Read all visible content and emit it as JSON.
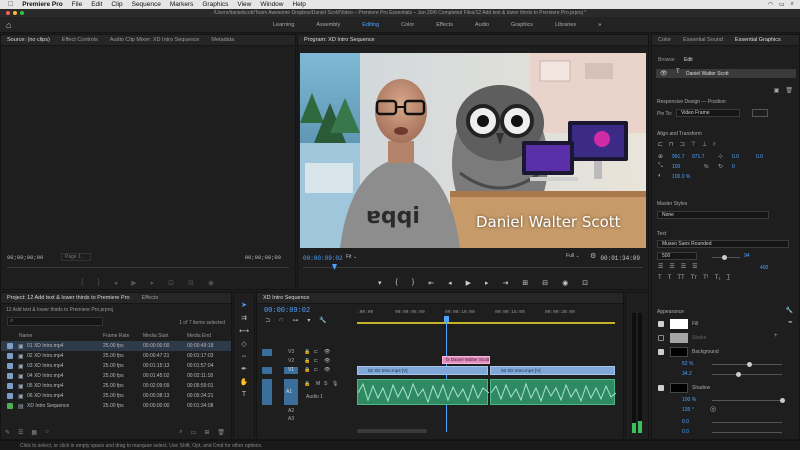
{
  "menubar": {
    "app": "Premiere Pro",
    "items": [
      "File",
      "Edit",
      "Clip",
      "Sequence",
      "Markers",
      "Graphics",
      "View",
      "Window",
      "Help"
    ],
    "clock": "Sat 1:03 pm"
  },
  "titlebar": {
    "title": "/Users/danielscott/Team Awesome Dropbox/Daniel Scott/Video – Premiere Pro Essentials – Jan 20/6 Completed Files/12 Add text & lower thirds to Premiere Pro.prproj *"
  },
  "workspaces": {
    "tabs": [
      "Learning",
      "Assembly",
      "Editing",
      "Color",
      "Effects",
      "Audio",
      "Graphics",
      "Libraries"
    ],
    "active": "Editing",
    "more": "»"
  },
  "source": {
    "tabs": [
      "Source: (no clips)",
      "Effect Controls",
      "Audio Clip Mixer: XD Intro Sequence",
      "Metadata"
    ],
    "tc_left": "00;00;00;00",
    "page": "Page 1",
    "tc_right": "00;00;00;00"
  },
  "program": {
    "tab": "Program: XD Intro Sequence",
    "tc_current": "00:00:09:02",
    "fit": "Fit",
    "quality": "Full",
    "tc_duration": "00:01:34:09",
    "lower_third": "Daniel Walter Scott"
  },
  "project": {
    "tabs": [
      "Project: 12 Add text & lower thirds to Premiere Pro",
      "Effects"
    ],
    "file": "12 Add text & lower thirds to Premiere Pro.prproj",
    "count": "1 of 7 items selected",
    "columns": [
      "Name",
      "Frame Rate",
      "Media Start",
      "Media End"
    ],
    "rows": [
      {
        "name": "01 XD Intro.mp4",
        "fps": "25.00 fps",
        "start": "00:00:00:00",
        "end": "00:00:49:18",
        "color": "#7b9fc8"
      },
      {
        "name": "02 XD Intro.mp4",
        "fps": "25.00 fps",
        "start": "00:00:47:21",
        "end": "00:01:17:03",
        "color": "#7b9fc8"
      },
      {
        "name": "03 XD Intro.mp4",
        "fps": "25.00 fps",
        "start": "00:01:15:13",
        "end": "00:01:57:04",
        "color": "#7b9fc8"
      },
      {
        "name": "04 XD Intro.mp4",
        "fps": "25.00 fps",
        "start": "00:01:45:02",
        "end": "00:02:11:18",
        "color": "#7b9fc8"
      },
      {
        "name": "05 XD Intro.mp4",
        "fps": "25.00 fps",
        "start": "00:02:09:09",
        "end": "00:05:59:01",
        "color": "#7b9fc8"
      },
      {
        "name": "06 XD Intro.mp4",
        "fps": "25.00 fps",
        "start": "00:00:38:13",
        "end": "00:05:34:21",
        "color": "#7b9fc8"
      },
      {
        "name": "XD Intro Sequence",
        "fps": "25.00 fps",
        "start": "00:00:00:00",
        "end": "00:01:34:08",
        "color": "#4caf50"
      }
    ]
  },
  "timeline": {
    "tab": "XD Intro Sequence",
    "timecode": "00:00:09:02",
    "ruler": [
      ":00:00",
      "00:00:05:00",
      "00:00:10:00",
      "00:00:15:00",
      "00:00:20:00"
    ],
    "title_clip": "Daniel Walter Scott",
    "clip1": "02 XD Intro.mp4 [V]",
    "clip2": "03 XD Intro.mp4 [V]",
    "audio_label": "Audio 1",
    "tracks_v": [
      "V3",
      "V2",
      "V1"
    ],
    "tracks_a": [
      "A1",
      "A2",
      "A3"
    ]
  },
  "egraphics": {
    "tabs": [
      "Color",
      "Essential Sound",
      "Essential Graphics"
    ],
    "subtabs": [
      "Browse",
      "Edit"
    ],
    "layer": "Daniel Walter Scott",
    "responsive": "Responsive Design — Position",
    "pin_label": "Pin To:",
    "pin_value": "Video Frame",
    "align": "Align and Transform",
    "pos_x": "991.7",
    "pos_y": "971.7",
    "rot": "0.0",
    "rot2": "0.0",
    "scale": "100",
    "scale_unit": "%",
    "anchor": "0",
    "opacity": "100.0 %",
    "master": "Master Styles",
    "master_value": "None",
    "text": "Text",
    "font": "Museo Sans Rounded",
    "weight": "500",
    "size": "94",
    "tracking": "400",
    "appearance": "Appearance",
    "fill": "Fill",
    "stroke": "Stroke",
    "background": "Background",
    "bg_opacity": "52 %",
    "bg_size": "34.2",
    "shadow": "Shadow",
    "sh_opacity": "100 %",
    "sh_angle": "135 °",
    "sh_distance": "0.0",
    "sh_blur": "0.0"
  },
  "status": "Click to select, or click in empty space and drag to marquee select. Use Shift, Opt, and Cmd for other options."
}
